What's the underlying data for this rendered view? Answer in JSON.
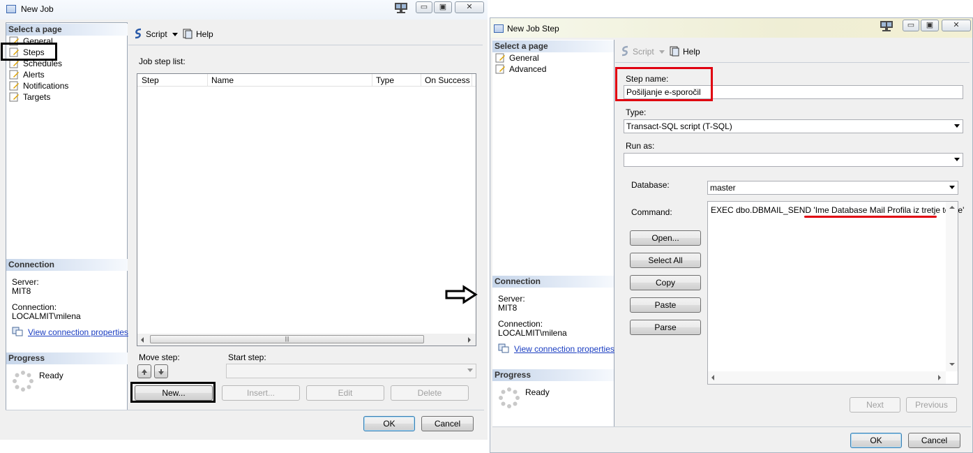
{
  "left_window": {
    "title": "New Job",
    "select_page": "Select a page",
    "nav": [
      "General",
      "Steps",
      "Schedules",
      "Alerts",
      "Notifications",
      "Targets"
    ],
    "toolbar": {
      "script": "Script",
      "help": "Help"
    },
    "job_step_list_label": "Job step list:",
    "columns": [
      "Step",
      "Name",
      "Type",
      "On Success"
    ],
    "connection_header": "Connection",
    "server_label": "Server:",
    "server_value": "MIT8",
    "connection_label": "Connection:",
    "connection_value": "LOCALMIT\\milena",
    "view_props": "View connection properties",
    "progress_header": "Progress",
    "progress_status": "Ready",
    "move_step": "Move step:",
    "start_step": "Start step:",
    "buttons": {
      "new": "New...",
      "insert": "Insert...",
      "edit": "Edit",
      "delete": "Delete",
      "ok": "OK",
      "cancel": "Cancel"
    }
  },
  "right_window": {
    "title": "New Job Step",
    "select_page": "Select a page",
    "nav": [
      "General",
      "Advanced"
    ],
    "toolbar": {
      "script": "Script",
      "help": "Help"
    },
    "step_name_label": "Step name:",
    "step_name_value": "Pošiljanje e-sporočil",
    "type_label": "Type:",
    "type_value": "Transact-SQL script (T-SQL)",
    "run_as_label": "Run as:",
    "run_as_value": "",
    "database_label": "Database:",
    "database_value": "master",
    "command_label": "Command:",
    "command_prefix": "EXEC  dbo.DBMAIL_SEND '",
    "command_highlight": "Ime Database Mail Profila iz tretje točke",
    "command_suffix": "'",
    "cmd_buttons": {
      "open": "Open...",
      "select_all": "Select All",
      "copy": "Copy",
      "paste": "Paste",
      "parse": "Parse"
    },
    "connection_header": "Connection",
    "server_label": "Server:",
    "server_value": "MIT8",
    "connection_label": "Connection:",
    "connection_value": "LOCALMIT\\milena",
    "view_props": "View connection properties",
    "progress_header": "Progress",
    "progress_status": "Ready",
    "buttons": {
      "next": "Next",
      "previous": "Previous",
      "ok": "OK",
      "cancel": "Cancel"
    }
  },
  "colors": {
    "highlight_black": "#000000",
    "highlight_red": "#e00010",
    "link": "#1a3dc1"
  }
}
